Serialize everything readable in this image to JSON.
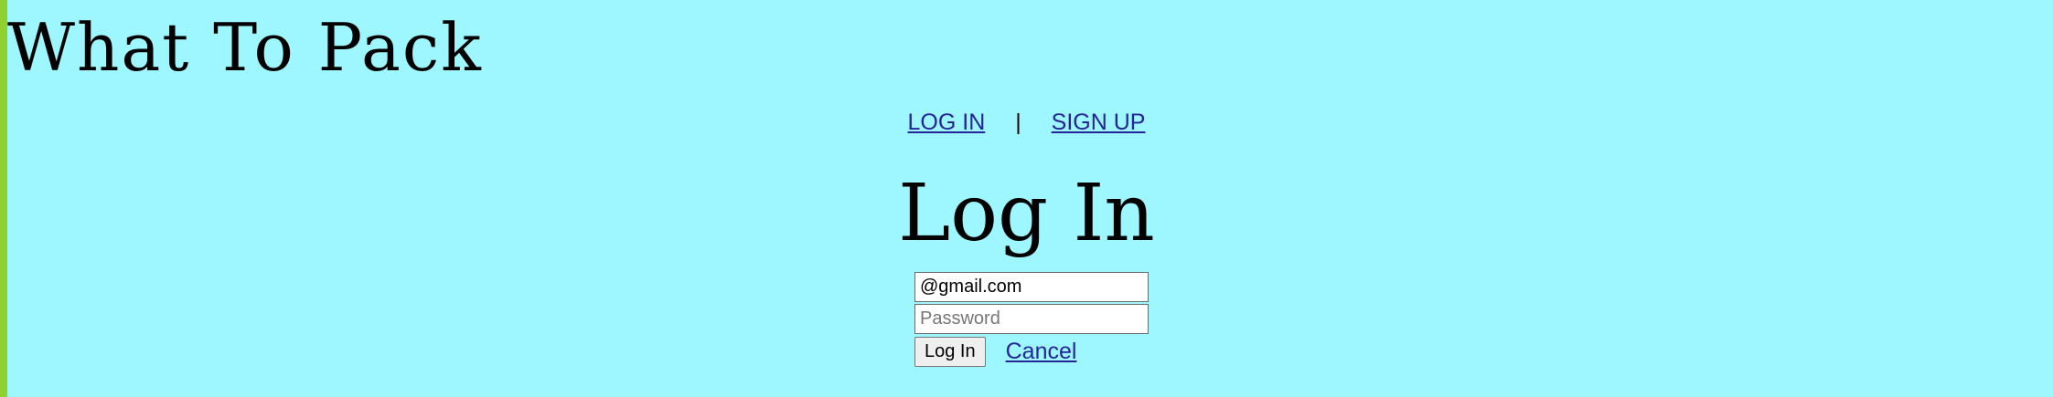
{
  "site": {
    "title": "What To Pack"
  },
  "nav": {
    "login_link": "LOG IN",
    "separator": "|",
    "signup_link": "SIGN UP"
  },
  "login": {
    "heading": "Log In",
    "email_value": "@gmail.com",
    "password_placeholder": "Password",
    "submit_label": "Log In",
    "cancel_label": "Cancel"
  },
  "colors": {
    "background": "#9ef6ff",
    "left_bar": "#8fd12e",
    "link": "#252598"
  }
}
